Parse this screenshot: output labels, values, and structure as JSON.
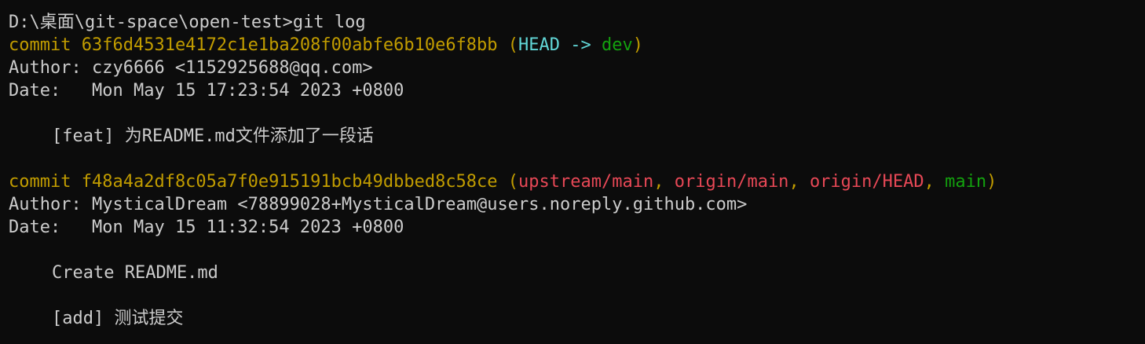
{
  "terminal": {
    "prompt": "D:\\桌面\\git-space\\open-test>",
    "command": "git log"
  },
  "commits": [
    {
      "commit_label": "commit",
      "hash": "63f6d4531e4172c1e1ba208f00abfe6b10e6f8bb",
      "head_ref": "HEAD",
      "arrow": "->",
      "branch": "dev",
      "author_label": "Author:",
      "author": "czy6666 <1152925688@qq.com>",
      "date_label": "Date:",
      "date": "Mon May 15 17:23:54 2023 +0800",
      "messages": [
        "[feat] 为README.md文件添加了一段话"
      ]
    },
    {
      "commit_label": "commit",
      "hash": "f48a4a2df8c05a7f0e915191bcb49dbbed8c58ce",
      "refs": {
        "upstream_main": "upstream/main",
        "origin_main": "origin/main",
        "origin_head": "origin/HEAD",
        "main": "main"
      },
      "author_label": "Author:",
      "author": "MysticalDream <78899028+MysticalDream@users.noreply.github.com>",
      "date_label": "Date:",
      "date": "Mon May 15 11:32:54 2023 +0800",
      "messages": [
        "Create README.md",
        "[add] 测试提交"
      ]
    }
  ],
  "colors": {
    "background": "#0c0c0c",
    "text": "#cccccc",
    "commit_yellow": "#c19c00",
    "head_cyan": "#61d6d6",
    "branch_green": "#13a10e",
    "remote_red": "#e74856"
  }
}
